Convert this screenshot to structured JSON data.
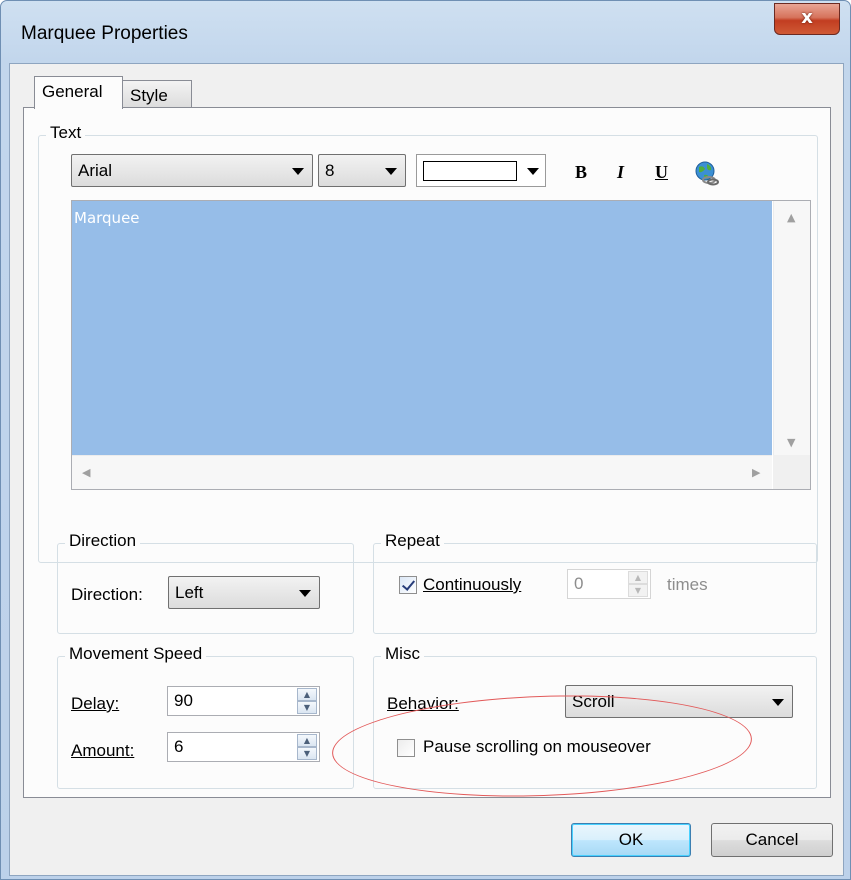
{
  "window": {
    "title": "Marquee Properties",
    "close_glyph": "x"
  },
  "tabs": [
    {
      "label": "General",
      "active": true
    },
    {
      "label": "Style",
      "active": false
    }
  ],
  "text_group": {
    "label": "Text",
    "font_value": "Arial",
    "size_value": "8",
    "bold_label": "B",
    "italic_label": "I",
    "underline_label": "U",
    "textarea_value": "Marquee",
    "selection_color": "#96bde8"
  },
  "direction_group": {
    "label": "Direction",
    "direction_label": "Direction:",
    "direction_value": "Left"
  },
  "repeat_group": {
    "label": "Repeat",
    "continuously_label": "Continuously",
    "continuously_checked": true,
    "times_value": "0",
    "times_label": "times"
  },
  "speed_group": {
    "label": "Movement Speed",
    "delay_label": "Delay:",
    "delay_value": "90",
    "amount_label": "Amount:",
    "amount_value": "6"
  },
  "misc_group": {
    "label": "Misc",
    "behavior_label": "Behavior:",
    "behavior_value": "Scroll",
    "pause_label": "Pause scrolling on mouseover",
    "pause_checked": false
  },
  "buttons": {
    "ok": "OK",
    "cancel": "Cancel"
  },
  "annotation": {
    "highlight_color": "#e25a5a"
  },
  "icons": {
    "hyperlink": "globe-link-icon",
    "dropdown": "chevron-down-icon",
    "spin_up": "spin-up-icon",
    "spin_down": "spin-down-icon"
  }
}
